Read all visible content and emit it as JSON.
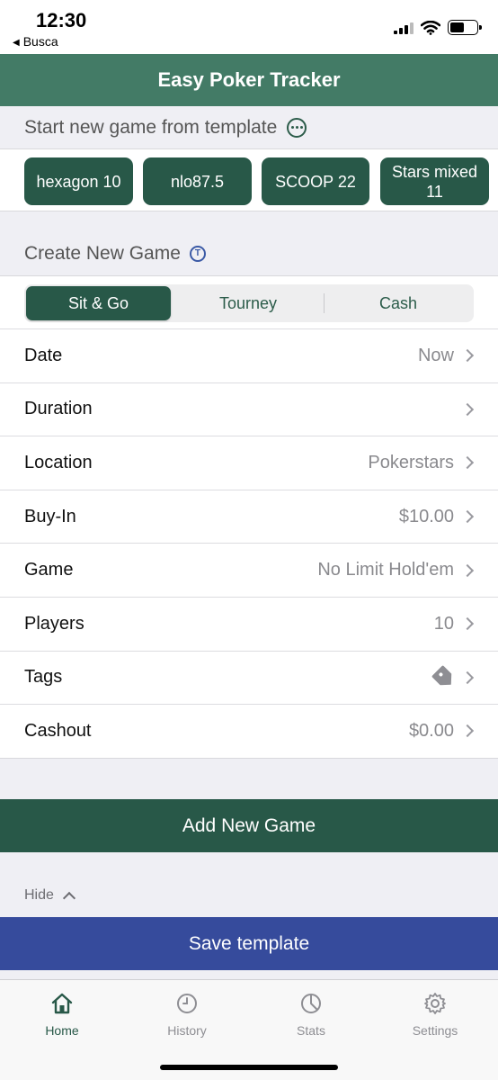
{
  "status": {
    "time": "12:30",
    "back_label": "Busca"
  },
  "header": {
    "title": "Easy Poker Tracker"
  },
  "templates": {
    "heading": "Start new game from template",
    "items": [
      "hexagon 10",
      "nlo87.5",
      "SCOOP 22",
      "Stars mixed 11"
    ]
  },
  "create": {
    "heading": "Create New Game",
    "segments": [
      "Sit & Go",
      "Tourney",
      "Cash"
    ],
    "selected_segment": "Sit & Go"
  },
  "form": {
    "rows": [
      {
        "label": "Date",
        "value": "Now"
      },
      {
        "label": "Duration",
        "value": ""
      },
      {
        "label": "Location",
        "value": "Pokerstars"
      },
      {
        "label": "Buy-In",
        "value": "$10.00"
      },
      {
        "label": "Game",
        "value": "No Limit Hold'em"
      },
      {
        "label": "Players",
        "value": "10"
      },
      {
        "label": "Tags",
        "value": "",
        "icon": "tag-icon"
      },
      {
        "label": "Cashout",
        "value": "$0.00"
      }
    ]
  },
  "actions": {
    "add_game": "Add New Game",
    "hide": "Hide",
    "save_template": "Save template"
  },
  "tabbar": {
    "tabs": [
      {
        "label": "Home",
        "icon": "home-icon",
        "active": true
      },
      {
        "label": "History",
        "icon": "clock-icon",
        "active": false
      },
      {
        "label": "Stats",
        "icon": "pie-chart-icon",
        "active": false
      },
      {
        "label": "Settings",
        "icon": "gear-icon",
        "active": false
      }
    ]
  },
  "colors": {
    "header": "#437b66",
    "primary": "#285848",
    "save": "#364b9c",
    "background": "#efeff4"
  }
}
